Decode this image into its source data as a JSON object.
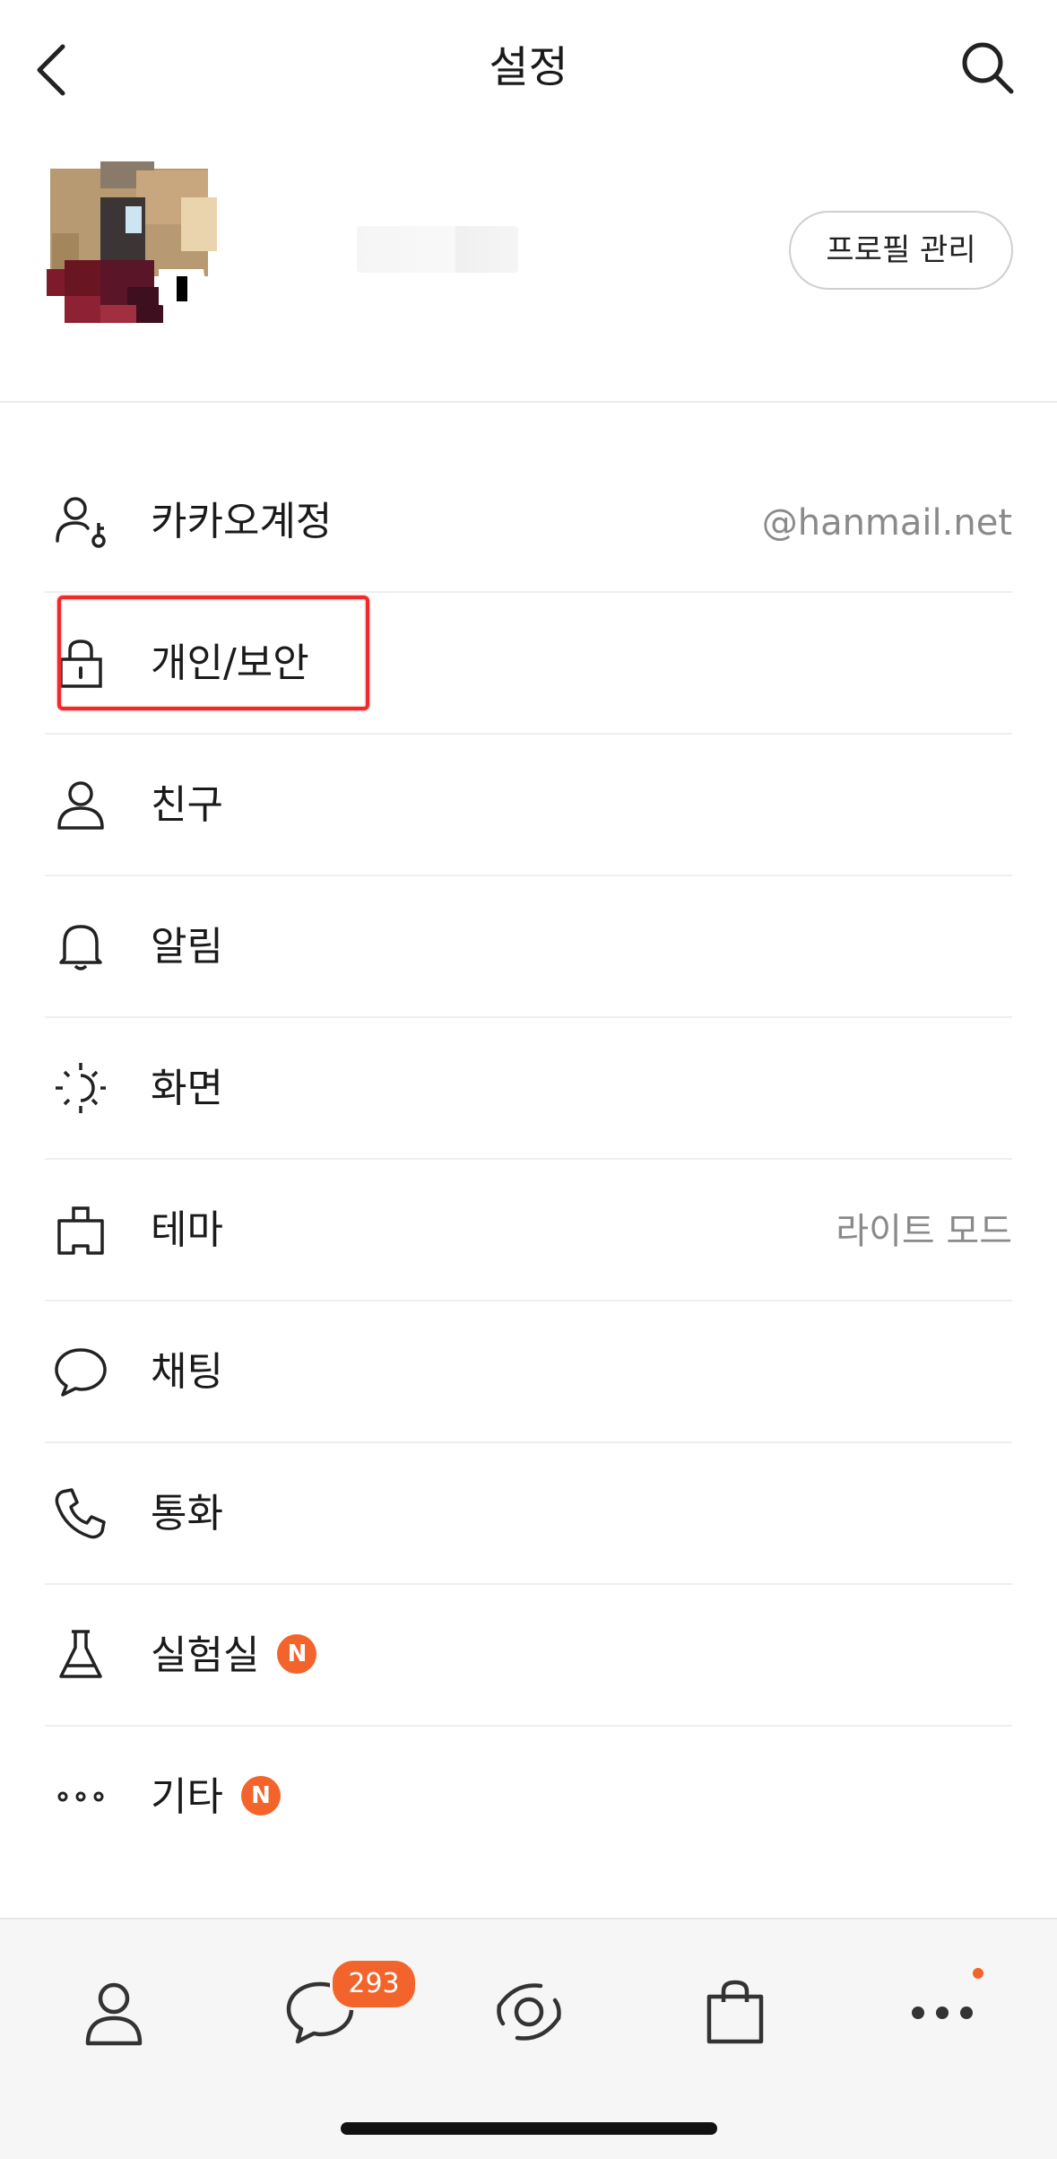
{
  "header": {
    "title": "설정",
    "back_icon": "chevron-left-icon",
    "search_icon": "search-icon"
  },
  "profile": {
    "manage_button": "프로필 관리"
  },
  "menu": {
    "items": [
      {
        "label": "카카오계정",
        "value": "@hanmail.net",
        "icon": "user-key-icon"
      },
      {
        "label": "개인/보안",
        "value": "",
        "icon": "lock-icon"
      },
      {
        "label": "친구",
        "value": "",
        "icon": "person-icon"
      },
      {
        "label": "알림",
        "value": "",
        "icon": "bell-icon"
      },
      {
        "label": "화면",
        "value": "",
        "icon": "brightness-icon"
      },
      {
        "label": "테마",
        "value": "라이트 모드",
        "icon": "theme-brush-icon"
      },
      {
        "label": "채팅",
        "value": "",
        "icon": "chat-bubble-icon"
      },
      {
        "label": "통화",
        "value": "",
        "icon": "phone-icon"
      },
      {
        "label": "실험실",
        "value": "",
        "icon": "flask-icon",
        "badge": "N"
      },
      {
        "label": "기타",
        "value": "",
        "icon": "more-dots-icon",
        "badge": "N"
      }
    ]
  },
  "tabbar": {
    "chat_badge": "293",
    "tabs": [
      "friends-tab-icon",
      "chats-tab-icon",
      "view-tab-icon",
      "shopping-tab-icon",
      "more-tab-icon"
    ]
  },
  "colors": {
    "accent": "#f2642b",
    "highlight": "#ef2a2a",
    "secondary_text": "#8a8a8a"
  }
}
